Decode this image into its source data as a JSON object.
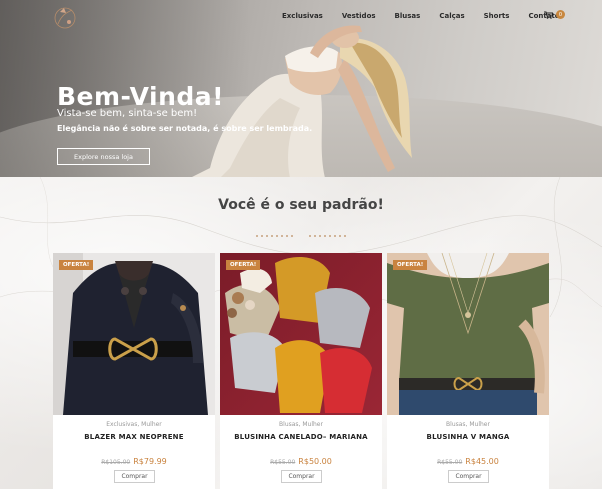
{
  "nav": {
    "items": [
      "Exclusivas",
      "Vestidos",
      "Blusas",
      "Calças",
      "Shorts",
      "Contato"
    ],
    "cart_count": "0"
  },
  "hero": {
    "title": "Bem-Vinda!",
    "subtitle": "Vista-se bem, sinta-se bem!",
    "tagline": "Elegância não é sobre ser notada, é sobre ser lembrada.",
    "button": "Explore nossa loja"
  },
  "section": {
    "title": "Você é o seu padrão!"
  },
  "products": [
    {
      "badge": "OFERTA!",
      "category": "Exclusivas, Mulher",
      "name": "BLAZER MAX NEOPRENE",
      "old_price": "R$105.00",
      "price": "R$79.99",
      "button": "Comprar"
    },
    {
      "badge": "OFERTA!",
      "category": "Blusas, Mulher",
      "name": "BLUSINHA CANELADO– MARIANA",
      "old_price": "R$55.00",
      "price": "R$50.00",
      "button": "Comprar"
    },
    {
      "badge": "OFERTA!",
      "category": "Blusas, Mulher",
      "name": "BLUSINHA V MANGA",
      "old_price": "R$55.00",
      "price": "R$45.00",
      "button": "Comprar"
    }
  ],
  "colors": {
    "accent": "#c9833f",
    "text": "#454545"
  }
}
